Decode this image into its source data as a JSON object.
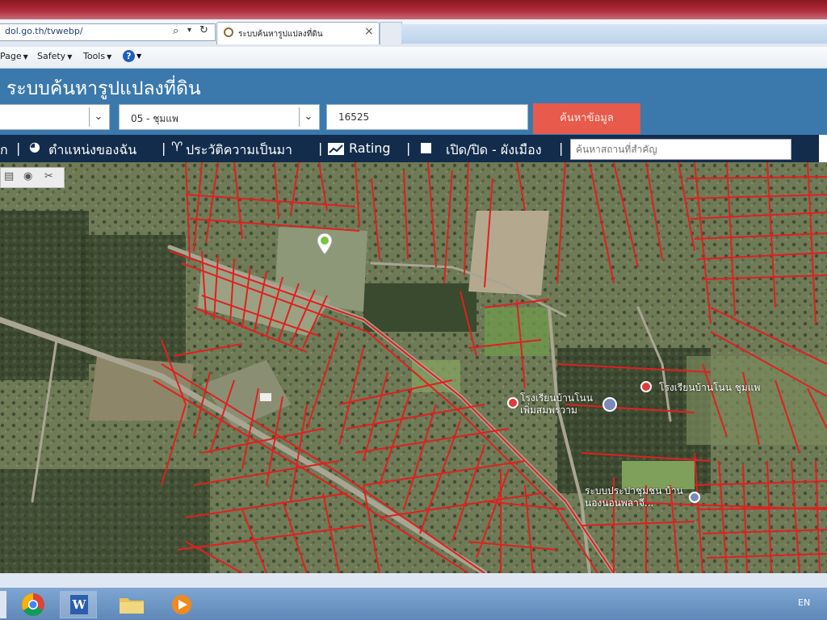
{
  "browser": {
    "address": "dol.go.th/tvwebp/",
    "tab_title": "ระบบค้นหารูปแปลงที่ดิน",
    "tab_close_label": "×",
    "menu": [
      {
        "label": "Page"
      },
      {
        "label": "Safety"
      },
      {
        "label": "Tools"
      }
    ],
    "help_label": "?"
  },
  "site": {
    "title": "ระบบค้นหารูปแปลงที่ดิน",
    "province_value": "",
    "district_value": "05 - ชุมแพ",
    "parcel_number": "16525",
    "search_button": "ค้นหาข้อมูล"
  },
  "toolbar": {
    "home_label": "ก",
    "location_label": "ตำแหน่งของฉัน",
    "history_label": "ประวัติความเป็นมา",
    "rating_label": "Rating",
    "cityplan_label": "เปิด/ปิด - ผังเมือง",
    "place_search_placeholder": "ค้นหาสถานที่สำคัญ",
    "separator": "|"
  },
  "map": {
    "poi_labels": [
      "โรงเรียนบ้านโนน ชุมแพ",
      "โรงเรียนบ้านโนน เพิ่มสมพรวาม",
      "ระบบประปาชุมชน บ้านนองนอนพลาจี..."
    ],
    "boundary_color": "#e02020"
  },
  "taskbar": {
    "language": "EN",
    "apps": [
      "chrome-icon",
      "word-icon",
      "folder-icon",
      "media-player-icon"
    ]
  }
}
